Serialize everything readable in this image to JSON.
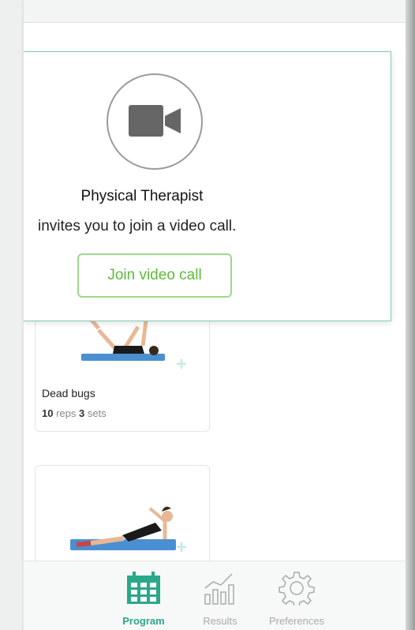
{
  "modal": {
    "title": "Physical Therapist",
    "message": "invites you to join a video call.",
    "join_button": "Join video call",
    "icon": "video-camera-icon"
  },
  "exercises": [
    {
      "name": "Dead bugs",
      "reps": "10",
      "reps_label": "reps",
      "sets": "3",
      "sets_label": "sets"
    },
    {
      "name": "",
      "reps": "",
      "reps_label": "",
      "sets": "",
      "sets_label": ""
    }
  ],
  "nav": [
    {
      "label": "Program",
      "icon": "calendar-icon",
      "active": true
    },
    {
      "label": "Results",
      "icon": "chart-icon",
      "active": false
    },
    {
      "label": "Preferences",
      "icon": "gear-icon",
      "active": false
    }
  ],
  "colors": {
    "accent": "#2aa88a",
    "button_text": "#5dbb3a",
    "button_border": "#9fd88a",
    "modal_border": "#7fcdb4"
  }
}
